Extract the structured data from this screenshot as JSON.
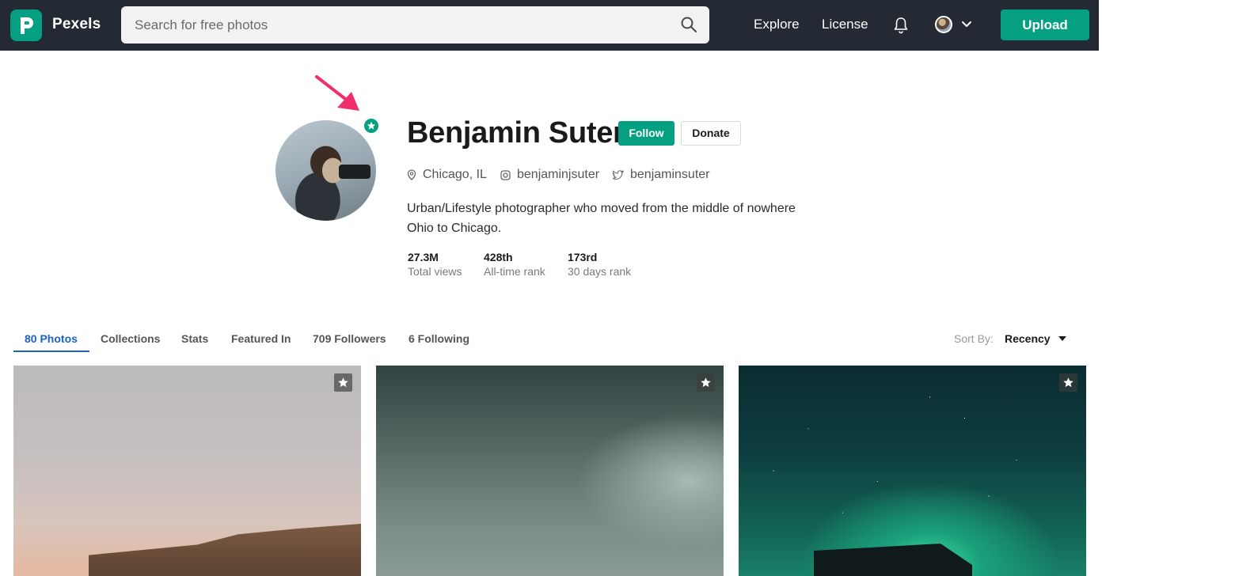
{
  "header": {
    "logo_text": "Pexels",
    "search_placeholder": "Search for free photos",
    "nav": [
      "Explore",
      "License"
    ],
    "upload_label": "Upload",
    "brand_color": "#05a081",
    "bar_color": "#232a34"
  },
  "profile": {
    "name": "Benjamin Suter",
    "follow_label": "Follow",
    "donate_label": "Donate",
    "location": "Chicago, IL",
    "instagram": "benjaminjsuter",
    "twitter": "benjaminsuter",
    "bio": "Urban/Lifestyle photographer who moved from the middle of nowhere Ohio to Chicago.",
    "stats": [
      {
        "value": "27.3M",
        "label": "Total views"
      },
      {
        "value": "428th",
        "label": "All-time rank"
      },
      {
        "value": "173rd",
        "label": "30 days rank"
      }
    ],
    "badge_icon": "star-icon"
  },
  "tabs": [
    "80 Photos",
    "Collections",
    "Stats",
    "Featured In",
    "709 Followers",
    "6 Following"
  ],
  "active_tab": "80 Photos",
  "sort": {
    "label": "Sort By:",
    "value": "Recency"
  },
  "photos": [
    {
      "name": "coastal-cliff-photo",
      "icon": "star-icon"
    },
    {
      "name": "foggy-sky-photo",
      "icon": "star-icon"
    },
    {
      "name": "aurora-night-photo",
      "icon": "star-icon"
    }
  ],
  "annotation_color": "#f0306c"
}
